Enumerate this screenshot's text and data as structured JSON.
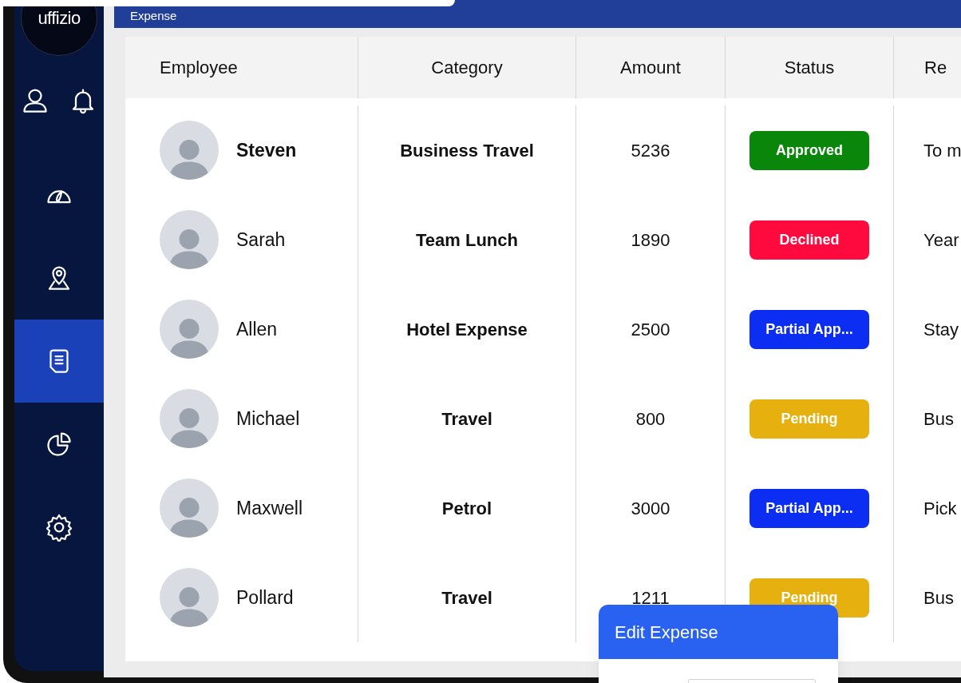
{
  "logo": "uffizio",
  "header": {
    "title": "Expense"
  },
  "sidebar": {
    "top_icons": [
      {
        "kind": "user"
      },
      {
        "kind": "bell"
      }
    ],
    "items": [
      {
        "kind": "gauge",
        "selected": false
      },
      {
        "kind": "pin",
        "selected": false
      },
      {
        "kind": "document",
        "selected": true
      },
      {
        "kind": "chart",
        "selected": false
      },
      {
        "kind": "gear",
        "selected": false
      }
    ]
  },
  "table": {
    "columns": [
      "Employee",
      "Category",
      "Amount",
      "Status",
      "Re"
    ],
    "rows": [
      {
        "employee": "Steven",
        "selected": true,
        "category": "Business Travel",
        "amount": "5236",
        "status": {
          "label": "Approved",
          "kind": "approved"
        },
        "column_5": "To m"
      },
      {
        "employee": "Sarah",
        "selected": false,
        "category": "Team Lunch",
        "amount": "1890",
        "status": {
          "label": "Declined",
          "kind": "declined"
        },
        "column_5": "Year"
      },
      {
        "employee": "Allen",
        "selected": false,
        "category": "Hotel Expense",
        "amount": "2500",
        "status": {
          "label": "Partial App...",
          "kind": "partial"
        },
        "column_5": "Stay"
      },
      {
        "employee": "Michael",
        "selected": false,
        "category": "Travel",
        "amount": "800",
        "status": {
          "label": "Pending",
          "kind": "pending"
        },
        "column_5": "Bus"
      },
      {
        "employee": "Maxwell",
        "selected": false,
        "category": "Petrol",
        "amount": "3000",
        "status": {
          "label": "Partial App...",
          "kind": "partial"
        },
        "column_5": "Pick"
      },
      {
        "employee": "Pollard",
        "selected": false,
        "category": "Travel",
        "amount": "1211",
        "status": {
          "label": "Pending",
          "kind": "pending"
        },
        "column_5": "Bus"
      }
    ]
  },
  "dialog": {
    "title": "Edit Expense"
  }
}
